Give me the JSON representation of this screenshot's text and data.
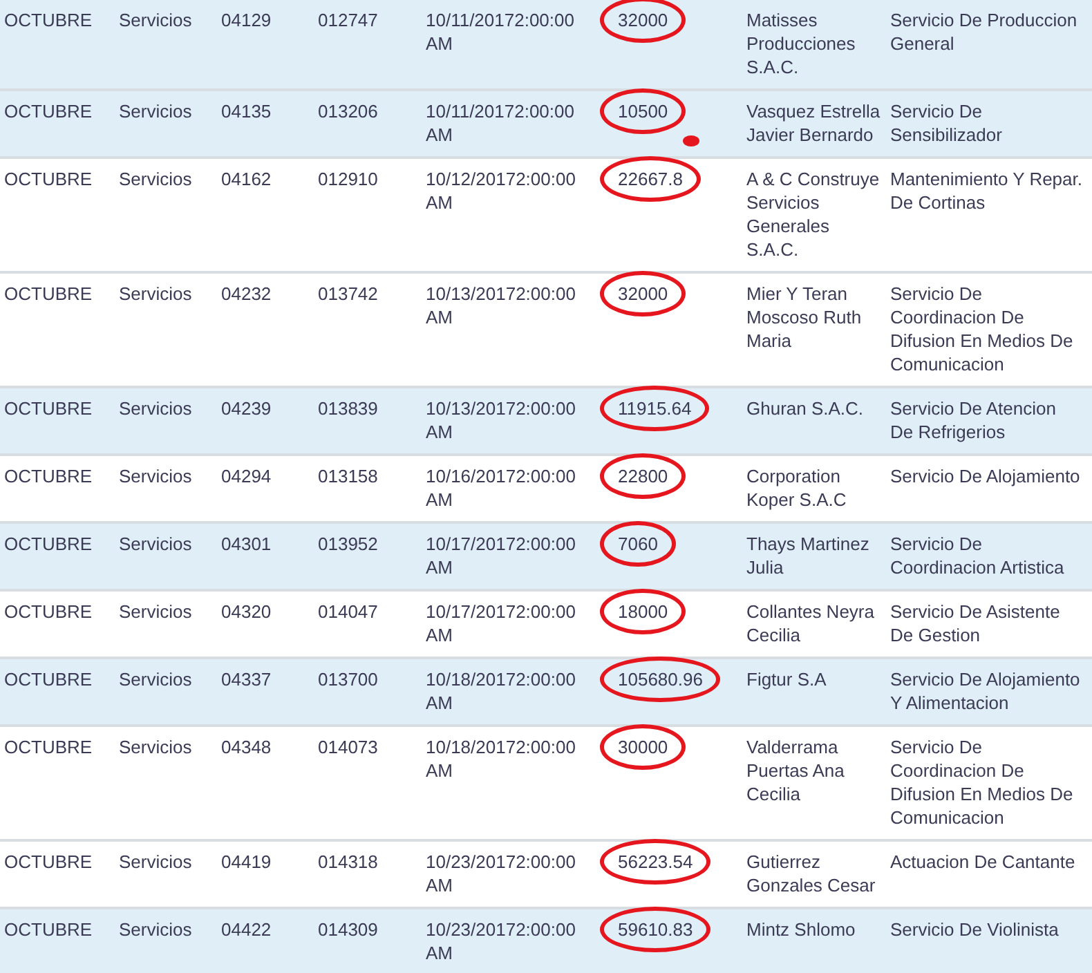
{
  "rows": [
    {
      "month": "OCTUBRE",
      "type": "Servicios",
      "code": "04129",
      "number": "012747",
      "date": "10/11/20172:00:00 AM",
      "amount": "32000",
      "circled": true,
      "supplier": "Matisses Producciones S.A.C.",
      "description": "Servicio De Produccion General",
      "shaded": true
    },
    {
      "month": "OCTUBRE",
      "type": "Servicios",
      "code": "04135",
      "number": "013206",
      "date": "10/11/20172:00:00 AM",
      "amount": "10500",
      "circled": true,
      "dot": true,
      "supplier": "Vasquez Estrella Javier Bernardo",
      "description": "Servicio De Sensibilizador",
      "shaded": true
    },
    {
      "month": "OCTUBRE",
      "type": "Servicios",
      "code": "04162",
      "number": "012910",
      "date": "10/12/20172:00:00 AM",
      "amount": "22667.8",
      "circled": true,
      "supplier": "A & C Construye Servicios Generales S.A.C.",
      "description": "Mantenimiento Y Repar. De Cortinas",
      "shaded": false
    },
    {
      "month": "OCTUBRE",
      "type": "Servicios",
      "code": "04232",
      "number": "013742",
      "date": "10/13/20172:00:00 AM",
      "amount": "32000",
      "circled": true,
      "supplier": "Mier Y Teran Moscoso Ruth Maria",
      "description": "Servicio De Coordinacion De Difusion En Medios De Comunicacion",
      "shaded": false
    },
    {
      "month": "OCTUBRE",
      "type": "Servicios",
      "code": "04239",
      "number": "013839",
      "date": "10/13/20172:00:00 AM",
      "amount": "11915.64",
      "circled": true,
      "supplier": "Ghuran S.A.C.",
      "description": "Servicio De Atencion De Refrigerios",
      "shaded": true
    },
    {
      "month": "OCTUBRE",
      "type": "Servicios",
      "code": "04294",
      "number": "013158",
      "date": "10/16/20172:00:00 AM",
      "amount": "22800",
      "circled": true,
      "supplier": "Corporation Koper S.A.C",
      "description": "Servicio De Alojamiento",
      "shaded": false
    },
    {
      "month": "OCTUBRE",
      "type": "Servicios",
      "code": "04301",
      "number": "013952",
      "date": "10/17/20172:00:00 AM",
      "amount": "7060",
      "circled": true,
      "supplier": "Thays Martinez Julia",
      "description": "Servicio De Coordinacion Artistica",
      "shaded": true
    },
    {
      "month": "OCTUBRE",
      "type": "Servicios",
      "code": "04320",
      "number": "014047",
      "date": "10/17/20172:00:00 AM",
      "amount": "18000",
      "circled": true,
      "supplier": "Collantes Neyra Cecilia",
      "description": "Servicio De Asistente De Gestion",
      "shaded": false
    },
    {
      "month": "OCTUBRE",
      "type": "Servicios",
      "code": "04337",
      "number": "013700",
      "date": "10/18/20172:00:00 AM",
      "amount": "105680.96",
      "circled": true,
      "supplier": "Figtur S.A",
      "description": "Servicio De Alojamiento Y Alimentacion",
      "shaded": true
    },
    {
      "month": "OCTUBRE",
      "type": "Servicios",
      "code": "04348",
      "number": "014073",
      "date": "10/18/20172:00:00 AM",
      "amount": "30000",
      "circled": true,
      "supplier": "Valderrama Puertas Ana Cecilia",
      "description": "Servicio De Coordinacion De Difusion En Medios De Comunicacion",
      "shaded": false
    },
    {
      "month": "OCTUBRE",
      "type": "Servicios",
      "code": "04419",
      "number": "014318",
      "date": "10/23/20172:00:00 AM",
      "amount": "56223.54",
      "circled": true,
      "supplier": "Gutierrez Gonzales Cesar",
      "description": "Actuacion De Cantante",
      "shaded": false
    },
    {
      "month": "OCTUBRE",
      "type": "Servicios",
      "code": "04422",
      "number": "014309",
      "date": "10/23/20172:00:00 AM",
      "amount": "59610.83",
      "circled": true,
      "supplier": "Mintz Shlomo",
      "description": "Servicio De Violinista",
      "shaded": true
    }
  ]
}
